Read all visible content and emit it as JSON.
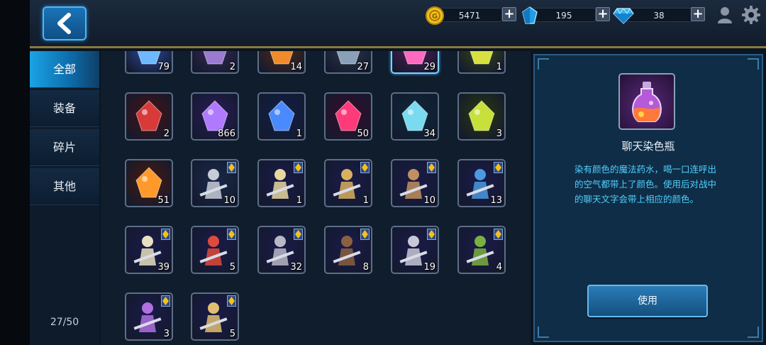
{
  "header": {
    "gold": "5471",
    "crystal": "195",
    "diamond": "38",
    "plus": "+"
  },
  "sidebar": {
    "tabs": [
      {
        "label": "全部",
        "active": true
      },
      {
        "label": "装备",
        "active": false
      },
      {
        "label": "碎片",
        "active": false
      },
      {
        "label": "其他",
        "active": false
      }
    ],
    "capacity": "27/50"
  },
  "inventory": {
    "rows": [
      [
        {
          "icon": "blue-crystal-pile-icon",
          "qty": "79"
        },
        {
          "icon": "dark-shards-icon",
          "qty": "2"
        },
        {
          "icon": "fire-tome-icon",
          "qty": "14"
        },
        {
          "icon": "iron-gauntlet-icon",
          "qty": "27"
        },
        {
          "icon": "magic-orb-icon",
          "qty": "29",
          "selected": true
        },
        {
          "icon": "green-ring-icon",
          "qty": "1"
        }
      ],
      [
        {
          "icon": "exp-potion-icon",
          "qty": "2"
        },
        {
          "icon": "purple-crystal-icon",
          "qty": "866"
        },
        {
          "icon": "blue-card-deck-icon",
          "qty": "1"
        },
        {
          "icon": "red-rose-icon",
          "qty": "50"
        },
        {
          "icon": "silver-key-icon",
          "qty": "34"
        },
        {
          "icon": "emerald-ring-icon",
          "qty": "3"
        }
      ],
      [
        {
          "icon": "gold-medal-icon",
          "qty": "51"
        },
        {
          "icon": "white-tiger-hero-icon",
          "qty": "10",
          "fragment": true
        },
        {
          "icon": "swordswoman-hero-icon",
          "qty": "1",
          "fragment": true
        },
        {
          "icon": "blonde-knight-hero-icon",
          "qty": "1",
          "fragment": true
        },
        {
          "icon": "barbarian-hero-icon",
          "qty": "10",
          "fragment": true
        },
        {
          "icon": "blue-hair-sorceress-hero-icon",
          "qty": "13",
          "fragment": true
        }
      ],
      [
        {
          "icon": "paladin-hero-icon",
          "qty": "39",
          "fragment": true
        },
        {
          "icon": "fire-mage-hero-icon",
          "qty": "5",
          "fragment": true
        },
        {
          "icon": "silver-ninja-hero-icon",
          "qty": "32",
          "fragment": true
        },
        {
          "icon": "bandit-hero-icon",
          "qty": "8",
          "fragment": true
        },
        {
          "icon": "white-hair-assassin-hero-icon",
          "qty": "19",
          "fragment": true
        },
        {
          "icon": "elf-archer-hero-icon",
          "qty": "4",
          "fragment": true
        }
      ],
      [
        {
          "icon": "crystal-golem-hero-icon",
          "qty": "3",
          "fragment": true
        },
        {
          "icon": "holy-warrior-hero-icon",
          "qty": "5",
          "fragment": true
        }
      ]
    ]
  },
  "detail": {
    "icon": "chat-dye-bottle-icon",
    "title": "聊天染色瓶",
    "description": "染有颜色的魔法药水，喝一口连呼出的空气都带上了颜色。使用后对战中的聊天文字会带上相应的颜色。",
    "use_button": "使用"
  },
  "colors": {
    "accent": "#1aa3e6",
    "description_text": "#4fd0ff",
    "gold_border": "#8b7a3e"
  }
}
